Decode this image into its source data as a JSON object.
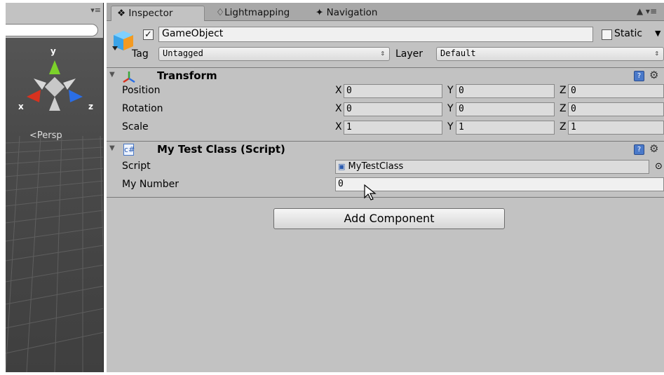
{
  "scene": {
    "gizmo_axes": {
      "y": "y",
      "x": "x",
      "z": "z"
    },
    "persp_label": "Persp",
    "menu_icon": "menu-icon"
  },
  "tabs": [
    {
      "label": "Inspector",
      "icon": "info-icon"
    },
    {
      "label": "Lightmapping",
      "icon": "lightbulb-icon"
    },
    {
      "label": "Navigation",
      "icon": "navigation-icon"
    }
  ],
  "header": {
    "active": true,
    "name": "GameObject",
    "static_label": "Static",
    "static_checked": false,
    "tag_label": "Tag",
    "tag_value": "Untagged",
    "layer_label": "Layer",
    "layer_value": "Default"
  },
  "transform": {
    "title": "Transform",
    "rows": [
      {
        "label": "Position",
        "x": "0",
        "y": "0",
        "z": "0"
      },
      {
        "label": "Rotation",
        "x": "0",
        "y": "0",
        "z": "0"
      },
      {
        "label": "Scale",
        "x": "1",
        "y": "1",
        "z": "1"
      }
    ],
    "axis_labels": {
      "x": "X",
      "y": "Y",
      "z": "Z"
    }
  },
  "script_component": {
    "title": "My Test Class (Script)",
    "script_label": "Script",
    "script_value": "MyTestClass",
    "number_label": "My Number",
    "number_value": "0"
  },
  "add_component_label": "Add Component",
  "colors": {
    "panel": "#c2c2c2",
    "tab_bar": "#a8a8a8",
    "axis_x": "#d8321f",
    "axis_y": "#7cd22a",
    "axis_z": "#2a6ee6"
  }
}
